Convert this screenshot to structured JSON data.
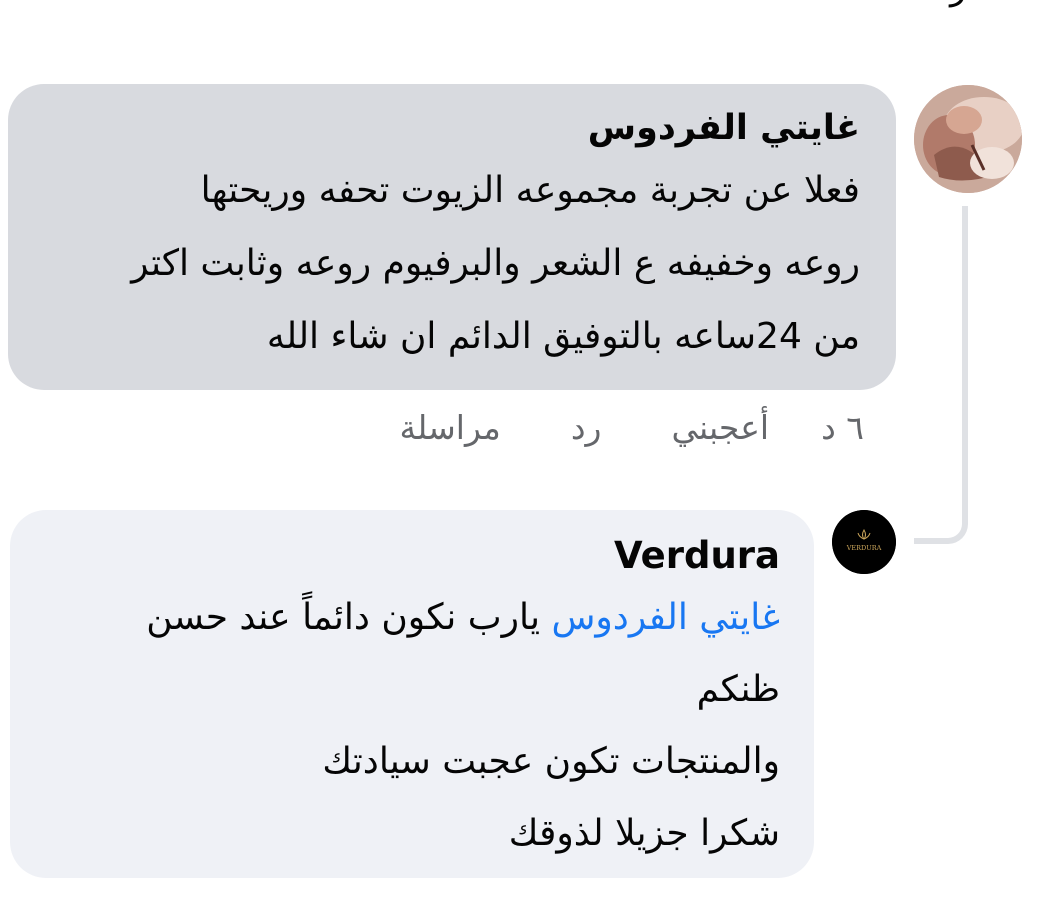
{
  "top_fragment": "الاكثر ملاءمة",
  "comment1": {
    "author": "غايتي الفردوس",
    "lines": [
      "فعلا عن تجربة مجموعه الزيوت تحفه وريحتها",
      "روعه وخفيفه ع الشعر والبرفيوم روعه وثابت اكتر",
      "من 24ساعه بالتوفيق الدائم ان شاء الله"
    ],
    "time": "٦ د",
    "like": "أعجبني",
    "reply": "رد",
    "message": "مراسلة"
  },
  "comment2": {
    "author": "Verdura",
    "logo_text": "VERDURA",
    "mention": "غايتي الفردوس",
    "line1_rest": " يارب نكون دائماً عند حسن",
    "lines": [
      "ظنكم",
      "والمنتجات تكون عجبت سيادتك",
      "شكرا جزيلا لذوقك"
    ]
  }
}
